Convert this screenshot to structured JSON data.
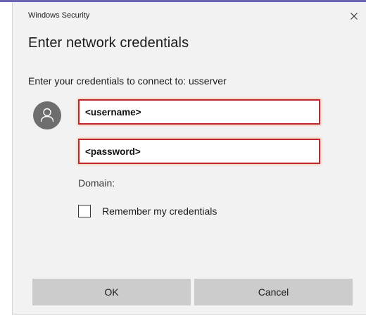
{
  "dialog": {
    "app_title": "Windows Security",
    "heading": "Enter network credentials",
    "instruction": "Enter your credentials to connect to: usserver",
    "close_icon": "close-icon",
    "avatar_icon": "user-icon"
  },
  "fields": {
    "username_value": "<username>",
    "password_value": "<password>",
    "error_border_color": "#c0262c"
  },
  "domain_label": "Domain:",
  "remember": {
    "label": "Remember my credentials",
    "checked": false
  },
  "buttons": {
    "ok_label": "OK",
    "cancel_label": "Cancel"
  },
  "colors": {
    "accent": "#6b63b5",
    "dialog_bg": "#f2f2f2",
    "button_bg": "#cccccc",
    "avatar_bg": "#6e6e6e"
  }
}
